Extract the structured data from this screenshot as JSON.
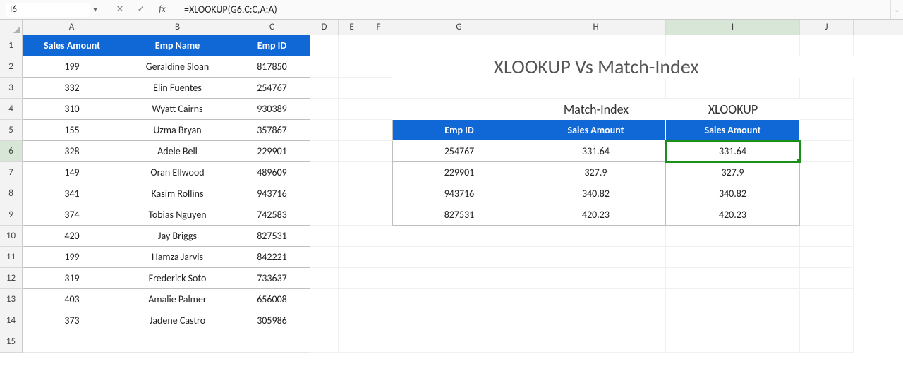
{
  "formula_bar": {
    "cell_ref": "I6",
    "cancel": "✕",
    "confirm": "✓",
    "fx": "fx",
    "formula": "=XLOOKUP(G6,C:C,A:A)",
    "dropdown": "▾",
    "expand": "⌄"
  },
  "columns": [
    "A",
    "B",
    "C",
    "D",
    "E",
    "F",
    "G",
    "H",
    "I",
    "J"
  ],
  "row_count": 15,
  "left_table": {
    "headers": {
      "a": "Sales Amount",
      "b": "Emp Name",
      "c": "Emp ID"
    },
    "rows": [
      {
        "a": "199",
        "b": "Geraldine Sloan",
        "c": "817850"
      },
      {
        "a": "332",
        "b": "Elin Fuentes",
        "c": "254767"
      },
      {
        "a": "310",
        "b": "Wyatt Cairns",
        "c": "930389"
      },
      {
        "a": "155",
        "b": "Uzma Bryan",
        "c": "357867"
      },
      {
        "a": "328",
        "b": "Adele Bell",
        "c": "229901"
      },
      {
        "a": "149",
        "b": "Oran Ellwood",
        "c": "489609"
      },
      {
        "a": "341",
        "b": "Kasim Rollins",
        "c": "943716"
      },
      {
        "a": "374",
        "b": "Tobias Nguyen",
        "c": "742583"
      },
      {
        "a": "420",
        "b": "Jay Briggs",
        "c": "827531"
      },
      {
        "a": "199",
        "b": "Hamza Jarvis",
        "c": "842221"
      },
      {
        "a": "319",
        "b": "Frederick Soto",
        "c": "733637"
      },
      {
        "a": "403",
        "b": "Amalie Palmer",
        "c": "656008"
      },
      {
        "a": "373",
        "b": "Jadene Castro",
        "c": "305986"
      }
    ]
  },
  "title": "XLOOKUP Vs Match-Index",
  "cmp": {
    "labels": {
      "h": "Match-Index",
      "i": "XLOOKUP"
    },
    "headers": {
      "g": "Emp ID",
      "h": "Sales Amount",
      "i": "Sales Amount"
    },
    "rows": [
      {
        "g": "254767",
        "h": "331.64",
        "i": "331.64"
      },
      {
        "g": "229901",
        "h": "327.9",
        "i": "327.9"
      },
      {
        "g": "943716",
        "h": "340.82",
        "i": "340.82"
      },
      {
        "g": "827531",
        "h": "420.23",
        "i": "420.23"
      }
    ]
  },
  "active_cell": "I6"
}
